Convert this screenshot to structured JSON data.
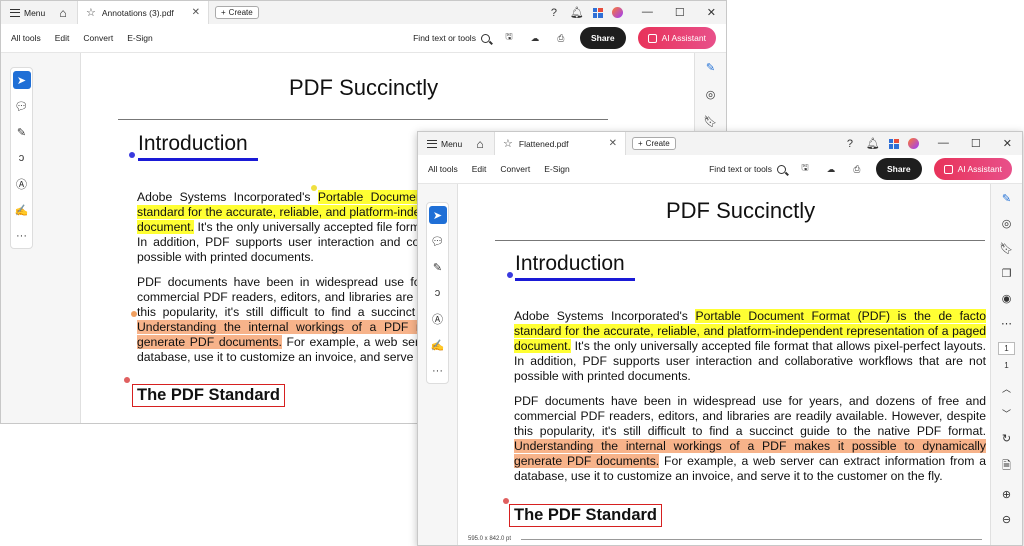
{
  "back_window": {
    "menu_label": "Menu",
    "tab_name": "Annotations (3).pdf",
    "create_label": "Create",
    "menus": [
      "All tools",
      "Edit",
      "Convert",
      "E-Sign"
    ],
    "find_label": "Find text or tools",
    "share_label": "Share",
    "ai_label": "AI Assistant"
  },
  "front_window": {
    "menu_label": "Menu",
    "tab_name": "Flattened.pdf",
    "create_label": "Create",
    "menus": [
      "All tools",
      "Edit",
      "Convert",
      "E-Sign"
    ],
    "find_label": "Find text or tools",
    "share_label": "Share",
    "ai_label": "AI Assistant",
    "page_current": "1",
    "page_total": "1",
    "page_size": "595.0 x 842.0 pt"
  },
  "document": {
    "title": "PDF Succinctly",
    "heading": "Introduction",
    "p1_a": "Adobe Systems Incorporated's ",
    "p1_hl": "Portable Document Format (PDF) is the de facto standard for the accurate, reliable, and platform-independent representation of a paged document.",
    "p1_b": " It's the only universally accepted file format that allows pixel-perfect layouts. In addition, PDF supports user interaction and collaborative workflows that are not possible with printed documents.",
    "p2_a": "PDF documents have been in widespread use for years, and dozens of free and commercial PDF readers, editors, and libraries are readily available. However, despite this popularity, it's still difficult to find a succinct guide to the native PDF format. ",
    "p2_hl": "Understanding the internal workings of a PDF makes it possible to dynamically generate PDF documents.",
    "p2_b": " For example, a web server can extract information from a database, use it to customize an invoice, and serve it to the customer on the fly.",
    "subheading": "The PDF Standard"
  },
  "colors": {
    "highlight_yellow": "#ffff33",
    "highlight_orange": "#f7b38a",
    "heading_underline": "#1a1ad6",
    "box_red": "#d62020",
    "ai_button": "#e8335a",
    "share_button": "#1e1e1e",
    "select_tool": "#1f6fd6"
  },
  "icons": [
    "hamburger-icon",
    "home-icon",
    "star-icon",
    "close-icon",
    "plus-icon",
    "help-icon",
    "bell-icon",
    "apps-grid-icon",
    "avatar-icon",
    "minimize-icon",
    "maximize-icon",
    "search-icon",
    "save-icon",
    "upload-icon",
    "print-icon",
    "select-cursor-icon",
    "comment-icon",
    "pen-icon",
    "lasso-icon",
    "text-select-icon",
    "fill-sign-icon",
    "more-icon",
    "annotate-icon",
    "scan-icon",
    "bookmark-icon",
    "pages-icon",
    "clock-icon",
    "refresh-icon",
    "zoom-in-icon",
    "zoom-out-icon",
    "chevron-up-icon",
    "chevron-down-icon",
    "document-icon"
  ]
}
